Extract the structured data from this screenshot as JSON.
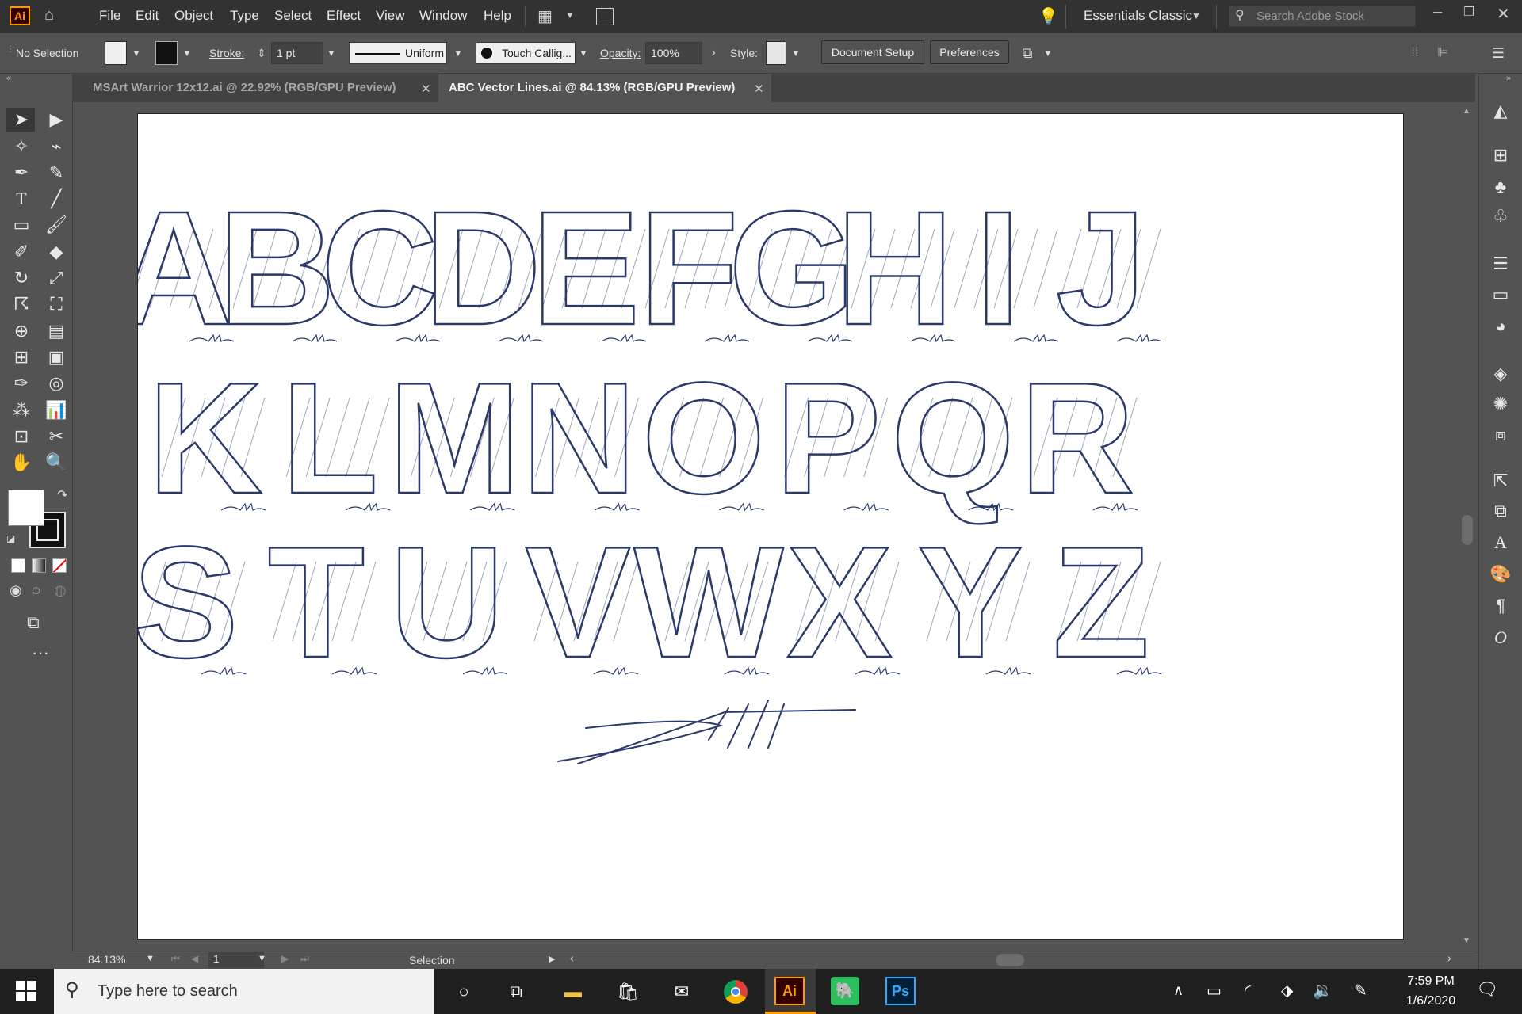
{
  "app": {
    "logo": "Ai"
  },
  "menubar": {
    "items": [
      "File",
      "Edit",
      "Object",
      "Type",
      "Select",
      "Effect",
      "View",
      "Window",
      "Help"
    ],
    "workspace": "Essentials Classic",
    "search_placeholder": "Search Adobe Stock"
  },
  "controlbar": {
    "selection": "No Selection",
    "stroke_label": "Stroke:",
    "stroke_value": "1 pt",
    "stroke_profile": "Uniform",
    "brush": "Touch Callig...",
    "opacity_label": "Opacity:",
    "opacity_value": "100%",
    "style_label": "Style:",
    "document_setup": "Document Setup",
    "preferences": "Preferences"
  },
  "tabs": [
    {
      "label": "MSArt Warrior 12x12.ai @ 22.92% (RGB/GPU Preview)",
      "active": false
    },
    {
      "label": "ABC Vector Lines.ai @ 84.13% (RGB/GPU Preview)",
      "active": true
    }
  ],
  "tab_close": "✕",
  "artwork": {
    "rows": [
      [
        "A",
        "B",
        "C",
        "D",
        "E",
        "F",
        "G",
        "H",
        "I",
        "J"
      ],
      [
        "K",
        "L",
        "M",
        "N",
        "O",
        "P",
        "Q",
        "R"
      ],
      [
        "S",
        "T",
        "U",
        "V",
        "W",
        "X",
        "Y",
        "Z"
      ]
    ],
    "ink_color": "#2b3a6b"
  },
  "statusbar": {
    "zoom": "84.13%",
    "artboard": "1",
    "tool": "Selection"
  },
  "taskbar": {
    "search_placeholder": "Type here to search",
    "ai_label": "Ai",
    "ps_label": "Ps",
    "time": "7:59 PM",
    "date": "1/6/2020"
  }
}
